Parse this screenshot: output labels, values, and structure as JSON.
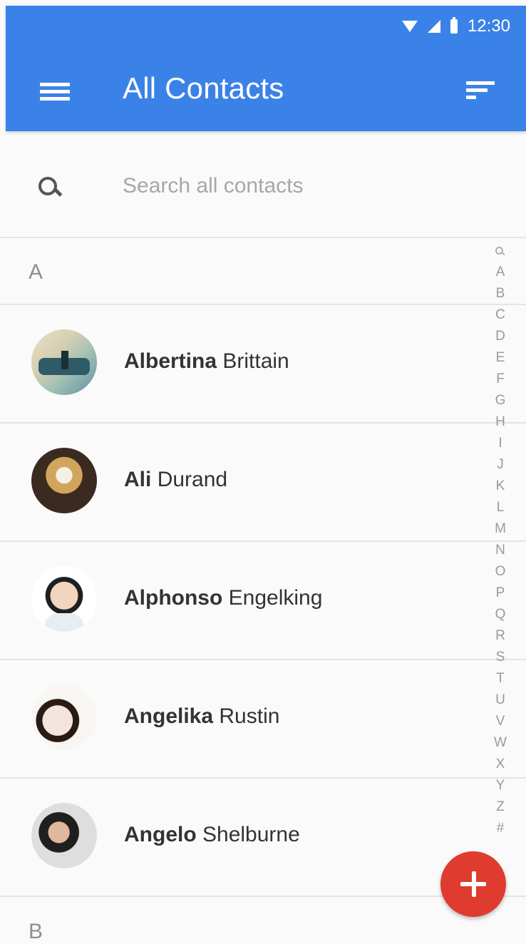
{
  "status_bar": {
    "time": "12:30"
  },
  "app_bar": {
    "title": "All Contacts"
  },
  "search": {
    "placeholder": "Search all contacts"
  },
  "sections": [
    {
      "letter": "A",
      "contacts": [
        {
          "first": "Albertina",
          "last": "Brittain"
        },
        {
          "first": "Ali",
          "last": "Durand"
        },
        {
          "first": "Alphonso",
          "last": "Engelking"
        },
        {
          "first": "Angelika",
          "last": "Rustin"
        },
        {
          "first": "Angelo",
          "last": "Shelburne"
        }
      ]
    },
    {
      "letter": "B"
    }
  ],
  "alphabet_index": [
    "A",
    "B",
    "C",
    "D",
    "E",
    "F",
    "G",
    "H",
    "I",
    "J",
    "K",
    "L",
    "M",
    "N",
    "O",
    "P",
    "Q",
    "R",
    "S",
    "T",
    "U",
    "V",
    "W",
    "X",
    "Y",
    "Z",
    "#"
  ],
  "colors": {
    "app_bar": "#3b82e8",
    "fab": "#df3b2f",
    "background": "#fafafa"
  },
  "icons": {
    "menu": "menu-icon",
    "sort": "sort-icon",
    "search": "search-icon",
    "add": "plus-icon"
  }
}
